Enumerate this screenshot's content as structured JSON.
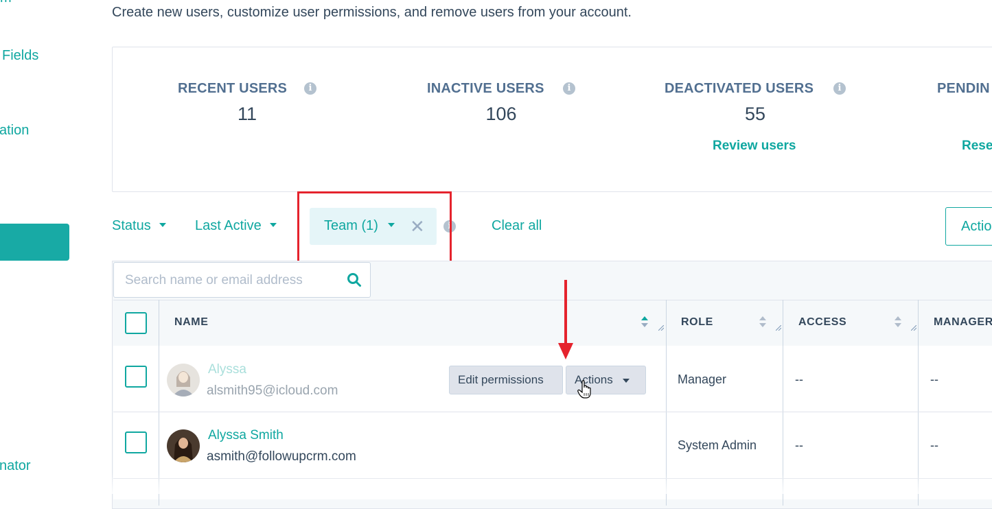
{
  "sidebar": {
    "items": [
      {
        "label": "m"
      },
      {
        "label": "Fields"
      },
      {
        "label": "ation"
      },
      {
        "label": ""
      },
      {
        "label": "nator"
      }
    ]
  },
  "header": {
    "description": "Create new users, customize user permissions, and remove users from your account."
  },
  "stats": [
    {
      "label": "RECENT USERS",
      "value": "11",
      "link": ""
    },
    {
      "label": "INACTIVE USERS",
      "value": "106",
      "link": ""
    },
    {
      "label": "DEACTIVATED USERS",
      "value": "55",
      "link": "Review users"
    },
    {
      "label": "PENDIN",
      "value": "",
      "link": "Rese"
    }
  ],
  "filters": {
    "status_label": "Status",
    "last_active_label": "Last Active",
    "team_label": "Team (1)",
    "clear_all_label": "Clear all",
    "actions_label": "Actio"
  },
  "search": {
    "placeholder": "Search name or email address"
  },
  "table": {
    "columns": [
      "NAME",
      "ROLE",
      "ACCESS",
      "MANAGER"
    ],
    "rows": [
      {
        "name": "Alyssa",
        "email": "alsmith95@icloud.com",
        "role": "Manager",
        "access": "--",
        "manager": "--"
      },
      {
        "name": "Alyssa Smith",
        "email": "asmith@followupcrm.com",
        "role": "System Admin",
        "access": "--",
        "manager": "--"
      }
    ],
    "row_actions": {
      "edit_permissions_label": "Edit permissions",
      "actions_label": "Actions"
    }
  },
  "colors": {
    "accent": "#0fa7a0",
    "annotation": "#e5232d",
    "text": "#33475b"
  }
}
